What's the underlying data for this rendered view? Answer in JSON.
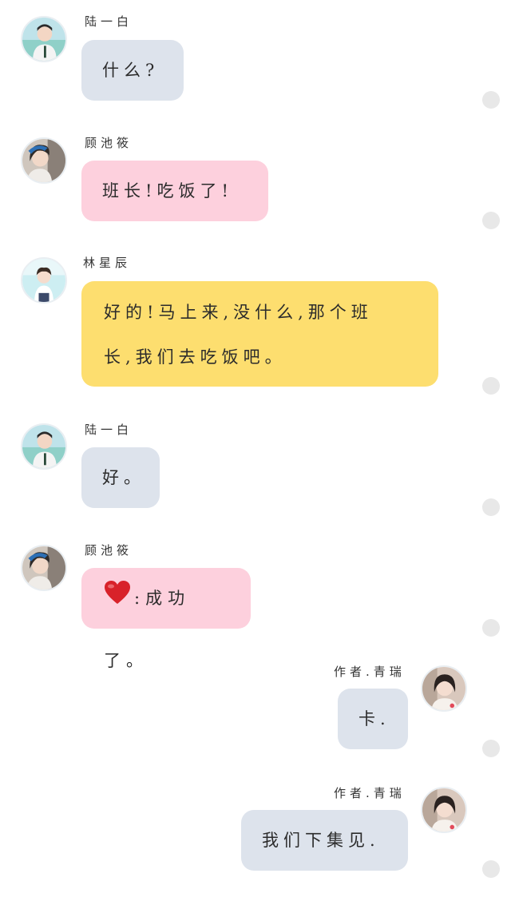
{
  "messages": [
    {
      "sender": "陆一白",
      "text": "什么?",
      "style": "gray",
      "side": "left",
      "avatar": "boy-avatar"
    },
    {
      "sender": "顾池筱",
      "text": "班长!吃饭了!",
      "style": "pink",
      "side": "left",
      "avatar": "girl-avatar"
    },
    {
      "sender": "林星辰",
      "text_line1": "好的!马上来,没什么,那个班",
      "text_line2": "长,我们去吃饭吧。",
      "style": "yellow",
      "side": "left",
      "avatar": "girl-avatar-2"
    },
    {
      "sender": "陆一白",
      "text": "好。",
      "style": "gray",
      "side": "left",
      "avatar": "boy-avatar"
    },
    {
      "sender": "顾池筱",
      "emoji": "heart-icon",
      "text": ":成功了。",
      "style": "pink",
      "side": "left",
      "avatar": "girl-avatar"
    },
    {
      "sender": "作者.青瑞",
      "text": "卡.",
      "style": "gray",
      "side": "right",
      "avatar": "author-avatar"
    },
    {
      "sender": "作者.青瑞",
      "text": "我们下集见.",
      "style": "gray",
      "side": "right",
      "avatar": "author-avatar"
    }
  ],
  "colors": {
    "gray_bubble": "#dde3ec",
    "pink_bubble": "#fdd0dd",
    "yellow_bubble": "#fdde6f",
    "heart": "#d8222a"
  }
}
